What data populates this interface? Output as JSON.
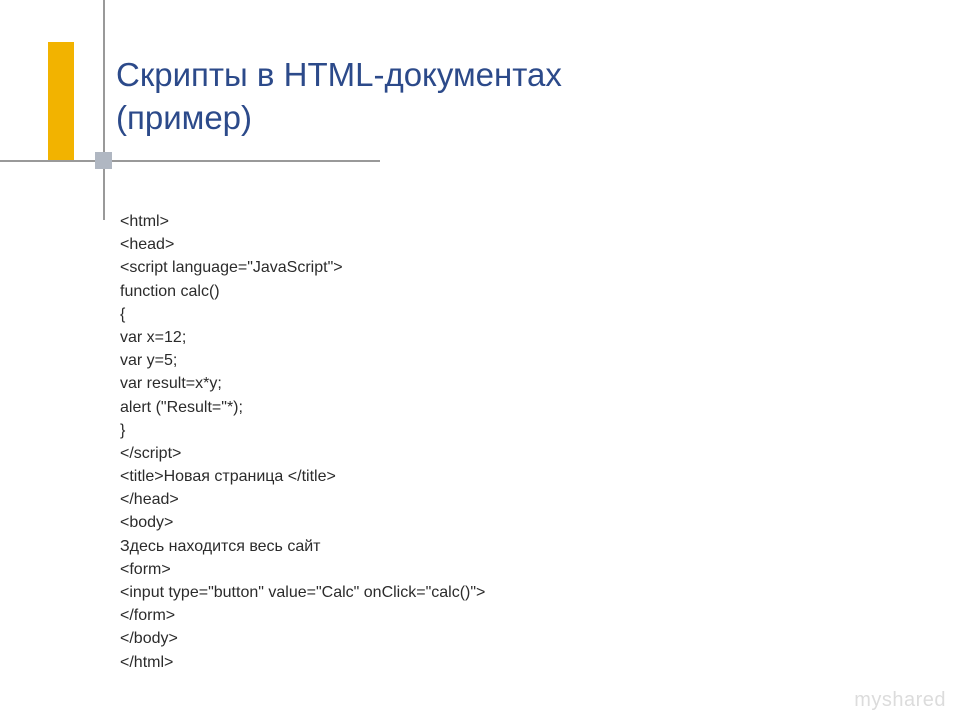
{
  "slide": {
    "title_line1": "Скрипты в HTML-документах",
    "title_line2": "(пример)",
    "code_lines": [
      "<html>",
      "<head>",
      "<script language=\"JavaScript\">",
      "function calc()",
      "{",
      "var x=12;",
      "var y=5;",
      "var result=x*y;",
      "alert (\"Result=\"*);",
      "}",
      "</script>",
      "<title>Новая страница </title>",
      "</head>",
      "<body>",
      "Здесь находится весь сайт",
      "<form>",
      "<input type=\"button\" value=\"Calc\" onClick=\"calc()\">",
      "</form>",
      "</body>",
      "</html>"
    ],
    "watermark": "myshared"
  }
}
